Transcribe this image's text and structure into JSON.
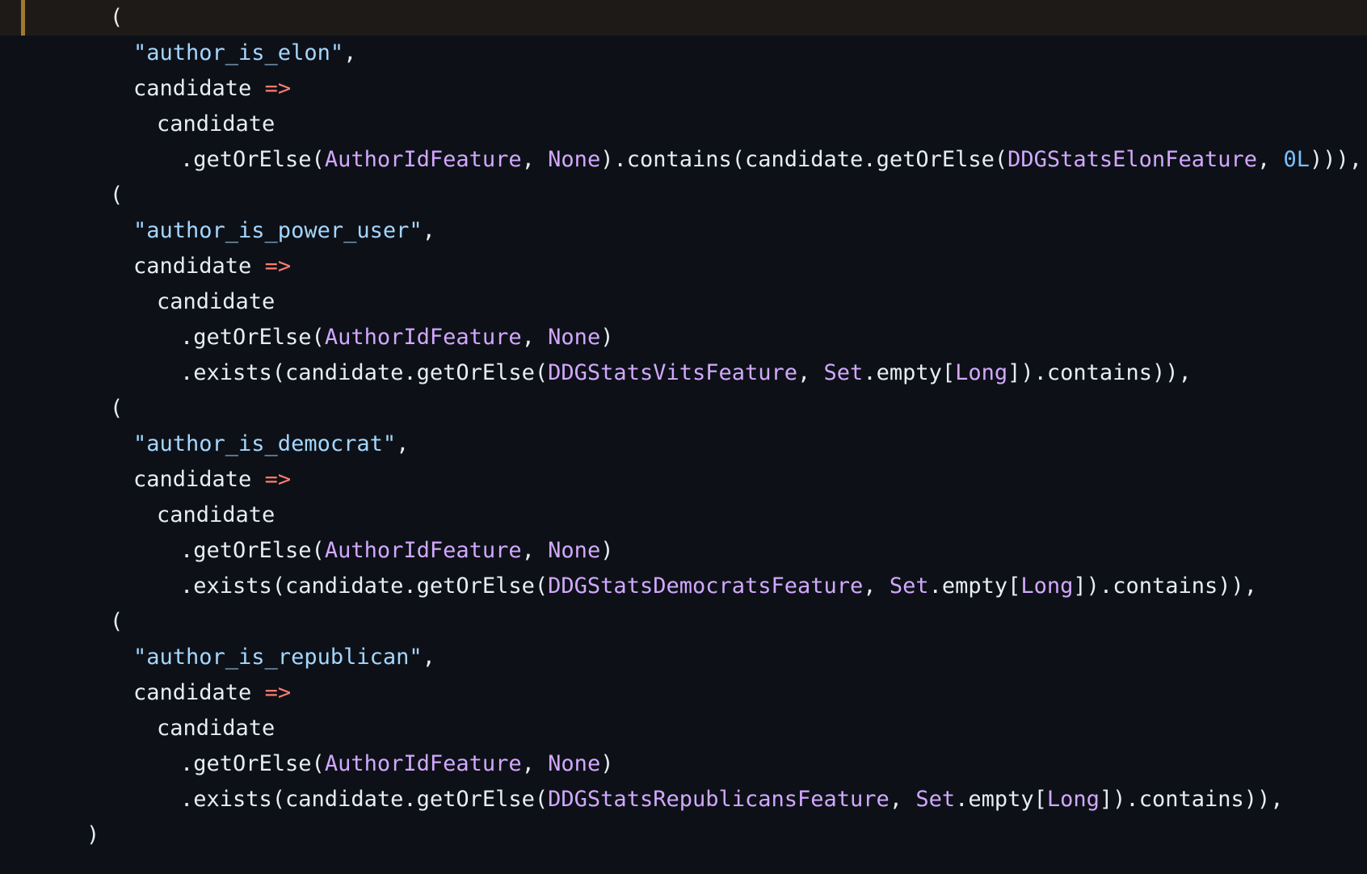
{
  "colors": {
    "background": "#0d1117",
    "current_line": "#1d1a17",
    "gutter_marker": "#9e7a2e",
    "text": "#e6edf3",
    "string": "#a5d6ff",
    "type": "#d2a8ff",
    "number": "#79c0ff",
    "operator": "#ff7b72"
  },
  "lines": [
    {
      "indent": 4,
      "current": true,
      "tokens": [
        {
          "t": "(",
          "c": "plain"
        }
      ]
    },
    {
      "indent": 5,
      "tokens": [
        {
          "t": "\"author_is_elon\"",
          "c": "str"
        },
        {
          "t": ",",
          "c": "plain"
        }
      ]
    },
    {
      "indent": 5,
      "tokens": [
        {
          "t": "candidate ",
          "c": "plain"
        },
        {
          "t": "=>",
          "c": "op"
        }
      ]
    },
    {
      "indent": 6,
      "tokens": [
        {
          "t": "candidate",
          "c": "plain"
        }
      ]
    },
    {
      "indent": 7,
      "tokens": [
        {
          "t": ".getOrElse(",
          "c": "plain"
        },
        {
          "t": "AuthorIdFeature",
          "c": "type"
        },
        {
          "t": ", ",
          "c": "plain"
        },
        {
          "t": "None",
          "c": "kw"
        },
        {
          "t": ").contains(candidate.getOrElse(",
          "c": "plain"
        },
        {
          "t": "DDGStatsElonFeature",
          "c": "type"
        },
        {
          "t": ", ",
          "c": "plain"
        },
        {
          "t": "0L",
          "c": "num"
        },
        {
          "t": "))),",
          "c": "plain"
        }
      ]
    },
    {
      "indent": 4,
      "tokens": [
        {
          "t": "(",
          "c": "plain"
        }
      ]
    },
    {
      "indent": 5,
      "tokens": [
        {
          "t": "\"author_is_power_user\"",
          "c": "str"
        },
        {
          "t": ",",
          "c": "plain"
        }
      ]
    },
    {
      "indent": 5,
      "tokens": [
        {
          "t": "candidate ",
          "c": "plain"
        },
        {
          "t": "=>",
          "c": "op"
        }
      ]
    },
    {
      "indent": 6,
      "tokens": [
        {
          "t": "candidate",
          "c": "plain"
        }
      ]
    },
    {
      "indent": 7,
      "tokens": [
        {
          "t": ".getOrElse(",
          "c": "plain"
        },
        {
          "t": "AuthorIdFeature",
          "c": "type"
        },
        {
          "t": ", ",
          "c": "plain"
        },
        {
          "t": "None",
          "c": "kw"
        },
        {
          "t": ")",
          "c": "plain"
        }
      ]
    },
    {
      "indent": 7,
      "tokens": [
        {
          "t": ".exists(candidate.getOrElse(",
          "c": "plain"
        },
        {
          "t": "DDGStatsVitsFeature",
          "c": "type"
        },
        {
          "t": ", ",
          "c": "plain"
        },
        {
          "t": "Set",
          "c": "type"
        },
        {
          "t": ".empty[",
          "c": "plain"
        },
        {
          "t": "Long",
          "c": "type"
        },
        {
          "t": "]).contains)),",
          "c": "plain"
        }
      ]
    },
    {
      "indent": 4,
      "tokens": [
        {
          "t": "(",
          "c": "plain"
        }
      ]
    },
    {
      "indent": 5,
      "tokens": [
        {
          "t": "\"author_is_democrat\"",
          "c": "str"
        },
        {
          "t": ",",
          "c": "plain"
        }
      ]
    },
    {
      "indent": 5,
      "tokens": [
        {
          "t": "candidate ",
          "c": "plain"
        },
        {
          "t": "=>",
          "c": "op"
        }
      ]
    },
    {
      "indent": 6,
      "tokens": [
        {
          "t": "candidate",
          "c": "plain"
        }
      ]
    },
    {
      "indent": 7,
      "tokens": [
        {
          "t": ".getOrElse(",
          "c": "plain"
        },
        {
          "t": "AuthorIdFeature",
          "c": "type"
        },
        {
          "t": ", ",
          "c": "plain"
        },
        {
          "t": "None",
          "c": "kw"
        },
        {
          "t": ")",
          "c": "plain"
        }
      ]
    },
    {
      "indent": 7,
      "tokens": [
        {
          "t": ".exists(candidate.getOrElse(",
          "c": "plain"
        },
        {
          "t": "DDGStatsDemocratsFeature",
          "c": "type"
        },
        {
          "t": ", ",
          "c": "plain"
        },
        {
          "t": "Set",
          "c": "type"
        },
        {
          "t": ".empty[",
          "c": "plain"
        },
        {
          "t": "Long",
          "c": "type"
        },
        {
          "t": "]).contains)),",
          "c": "plain"
        }
      ]
    },
    {
      "indent": 4,
      "tokens": [
        {
          "t": "(",
          "c": "plain"
        }
      ]
    },
    {
      "indent": 5,
      "tokens": [
        {
          "t": "\"author_is_republican\"",
          "c": "str"
        },
        {
          "t": ",",
          "c": "plain"
        }
      ]
    },
    {
      "indent": 5,
      "tokens": [
        {
          "t": "candidate ",
          "c": "plain"
        },
        {
          "t": "=>",
          "c": "op"
        }
      ]
    },
    {
      "indent": 6,
      "tokens": [
        {
          "t": "candidate",
          "c": "plain"
        }
      ]
    },
    {
      "indent": 7,
      "tokens": [
        {
          "t": ".getOrElse(",
          "c": "plain"
        },
        {
          "t": "AuthorIdFeature",
          "c": "type"
        },
        {
          "t": ", ",
          "c": "plain"
        },
        {
          "t": "None",
          "c": "kw"
        },
        {
          "t": ")",
          "c": "plain"
        }
      ]
    },
    {
      "indent": 7,
      "tokens": [
        {
          "t": ".exists(candidate.getOrElse(",
          "c": "plain"
        },
        {
          "t": "DDGStatsRepublicansFeature",
          "c": "type"
        },
        {
          "t": ", ",
          "c": "plain"
        },
        {
          "t": "Set",
          "c": "type"
        },
        {
          "t": ".empty[",
          "c": "plain"
        },
        {
          "t": "Long",
          "c": "type"
        },
        {
          "t": "]).contains)),",
          "c": "plain"
        }
      ]
    },
    {
      "indent": 3,
      "tokens": [
        {
          "t": ")",
          "c": "plain"
        }
      ]
    }
  ]
}
